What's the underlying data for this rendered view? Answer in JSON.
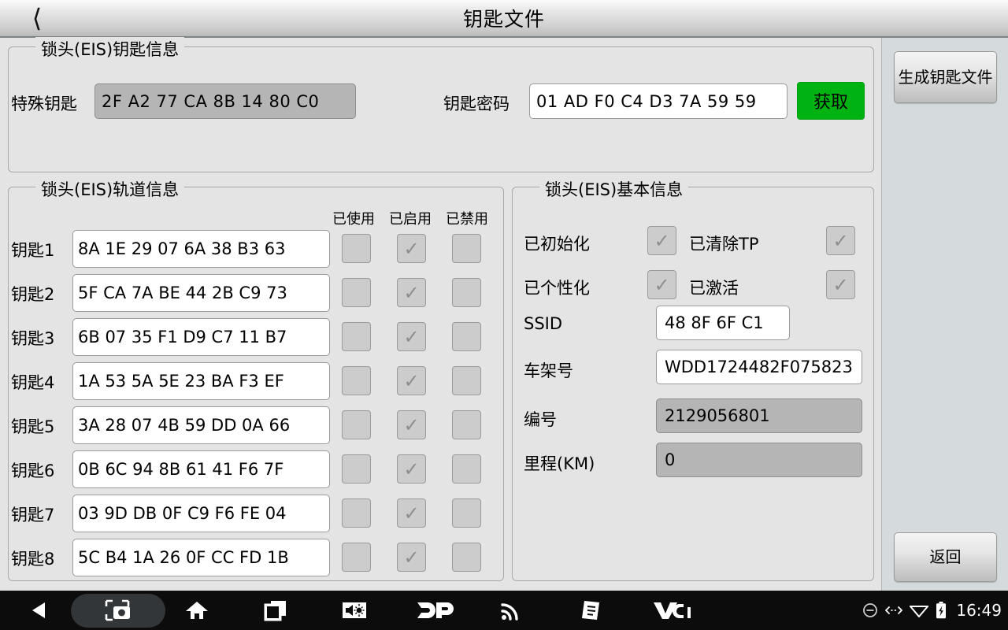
{
  "titlebar": {
    "back_icon": "chevron-left-icon",
    "title": "钥匙文件"
  },
  "sidebar": {
    "generate_button": "生成钥匙文件",
    "back_button": "返回"
  },
  "key_info_group": {
    "legend": "锁头(EIS)钥匙信息",
    "special_key_label": "特殊钥匙",
    "special_key_value": "2F  A2  77  CA  8B  14  80  C0",
    "password_label": "钥匙密码",
    "password_value": "01  AD  F0  C4  D3  7A  59  59",
    "fetch_button": "获取"
  },
  "track_group": {
    "legend": "锁头(EIS)轨道信息",
    "columns": [
      "已使用",
      "已启用",
      "已禁用"
    ],
    "rows": [
      {
        "label": "钥匙1",
        "value": "8A  1E  29  07  6A  38  B3  63",
        "used": false,
        "enabled": true,
        "disabled": false
      },
      {
        "label": "钥匙2",
        "value": "5F  CA  7A  BE  44  2B  C9  73",
        "used": false,
        "enabled": true,
        "disabled": false
      },
      {
        "label": "钥匙3",
        "value": "6B  07  35  F1  D9  C7  11  B7",
        "used": false,
        "enabled": true,
        "disabled": false
      },
      {
        "label": "钥匙4",
        "value": "1A  53  5A  5E  23  BA  F3  EF",
        "used": false,
        "enabled": true,
        "disabled": false
      },
      {
        "label": "钥匙5",
        "value": "3A  28  07  4B  59  DD  0A  66",
        "used": false,
        "enabled": true,
        "disabled": false
      },
      {
        "label": "钥匙6",
        "value": "0B  6C  94  8B  61  41  F6  7F",
        "used": false,
        "enabled": true,
        "disabled": false
      },
      {
        "label": "钥匙7",
        "value": "03  9D  DB  0F  C9  F6  FE  04",
        "used": false,
        "enabled": true,
        "disabled": false
      },
      {
        "label": "钥匙8",
        "value": "5C  B4  1A  26  0F  CC  FD  1B",
        "used": false,
        "enabled": true,
        "disabled": false
      }
    ]
  },
  "basic_group": {
    "legend": "锁头(EIS)基本信息",
    "initialized_label": "已初始化",
    "initialized_checked": true,
    "tp_cleared_label": "已清除TP",
    "tp_cleared_checked": true,
    "personalized_label": "已个性化",
    "personalized_checked": true,
    "activated_label": "已激活",
    "activated_checked": true,
    "ssid_label": "SSID",
    "ssid_value": "48  8F  6F  C1",
    "vin_label": "车架号",
    "vin_value": "WDD1724482F075823",
    "number_label": "编号",
    "number_value": "2129056801",
    "mileage_label": "里程(KM)",
    "mileage_value": "0"
  },
  "navbar": {
    "items": [
      "back-triangle-icon",
      "screenshot-camera-icon",
      "home-icon",
      "recents-icon",
      "volume-brightness-icon",
      "dp-logo-icon",
      "signal-waves-icon",
      "document-icon",
      "vci-logo-icon"
    ],
    "tray": {
      "dnd_icon": "do-not-disturb-icon",
      "usb_icon": "usb-transfer-icon",
      "wifi_icon": "wifi-icon",
      "battery_icon": "battery-charging-icon",
      "clock": "16:49"
    }
  },
  "colors": {
    "page_bg": "#e4e4e4",
    "sidebar_bg": "#d5dadd",
    "accent_green": "#00b312",
    "navbar_bg": "#0c0c0c",
    "disabled_field": "#b5b5b5"
  }
}
